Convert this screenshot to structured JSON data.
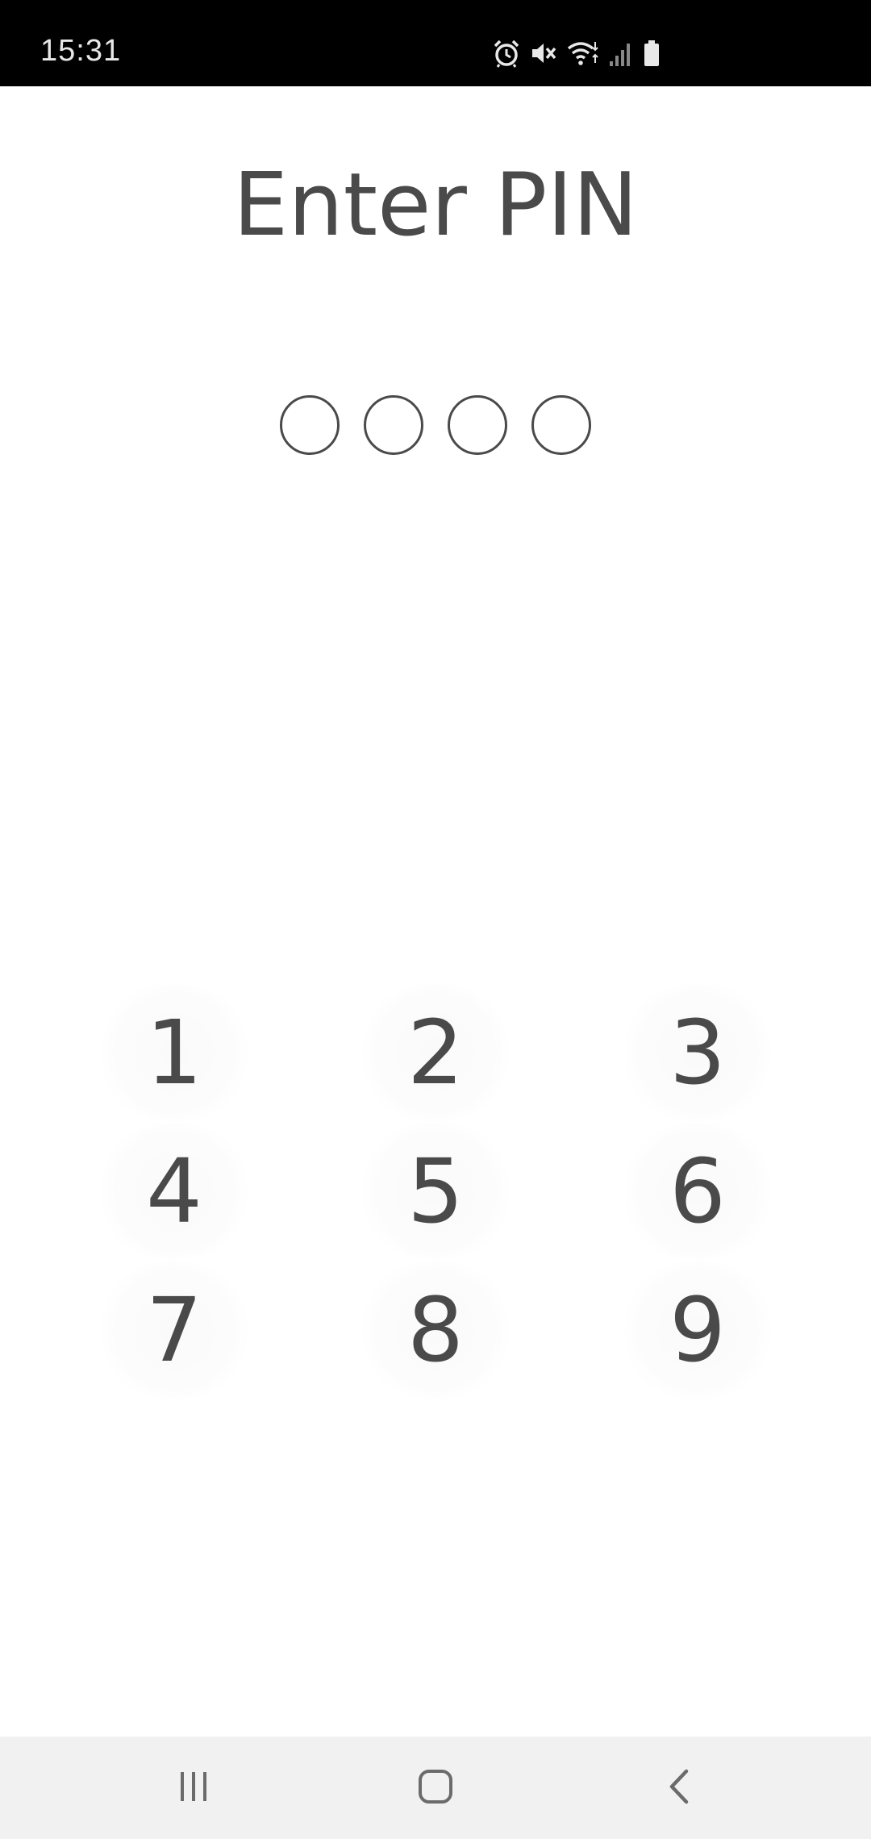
{
  "status_bar": {
    "time": "15:31",
    "icons": [
      "alarm-icon",
      "mute-icon",
      "wifi-icon",
      "signal-icon",
      "battery-icon"
    ]
  },
  "title": "Enter PIN",
  "pin": {
    "length": 4,
    "filled": 0
  },
  "keypad": {
    "keys": [
      "1",
      "2",
      "3",
      "4",
      "5",
      "6",
      "7",
      "8",
      "9"
    ]
  },
  "nav_bar": {
    "buttons": [
      "recents-icon",
      "home-icon",
      "back-icon"
    ]
  },
  "colors": {
    "text": "#4a4a4a",
    "status_bar_bg": "#000000",
    "nav_bar_bg": "#f1f1f1",
    "background": "#ffffff"
  }
}
